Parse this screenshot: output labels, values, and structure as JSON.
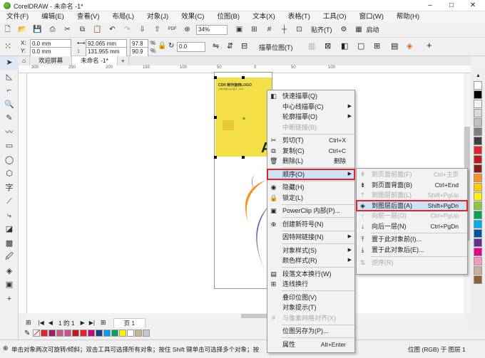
{
  "title": "CorelDRAW - 未命名 -1*",
  "menubar": [
    "文件(F)",
    "编辑(E)",
    "查看(V)",
    "布局(L)",
    "对象(J)",
    "效果(C)",
    "位图(B)",
    "文本(X)",
    "表格(T)",
    "工具(O)",
    "窗口(W)",
    "帮助(H)"
  ],
  "toolbar": {
    "zoom": "34%",
    "snap": "贴齐(T)",
    "launch": "启动"
  },
  "props": {
    "x": "0.0 mm",
    "y": "0.0 mm",
    "w": "92.065 mm",
    "h": "131.955 mm",
    "sx": "97.8",
    "sy": "90.9",
    "pct": "%",
    "angle": "0.0",
    "trace": "描摹位图(T)"
  },
  "tabs": [
    "欢迎屏幕",
    "未命名 -1*"
  ],
  "ruler": [
    "300",
    "250",
    "200",
    "150",
    "100",
    "50",
    "0",
    "50",
    "100"
  ],
  "poster": {
    "brand": "CDR 制作旋转LOGO",
    "sub": "小帆 科技 logo 设计 · corel",
    "letter": "A"
  },
  "menu": [
    {
      "label": "快速描摹(Q)",
      "icon": "trace-icon"
    },
    {
      "label": "中心线描摹(C)",
      "arrow": true
    },
    {
      "label": "轮廓描摹(O)",
      "arrow": true
    },
    {
      "label": "中断链接(B)",
      "dis": true
    },
    {
      "sep": true
    },
    {
      "label": "剪切(T)",
      "sc": "Ctrl+X",
      "icon": "cut-icon"
    },
    {
      "label": "复制(C)",
      "sc": "Ctrl+C",
      "icon": "copy-icon"
    },
    {
      "label": "删除(L)",
      "sc": "删除",
      "icon": "delete-icon"
    },
    {
      "sep": true
    },
    {
      "label": "顺序(O)",
      "arrow": true,
      "hl": true
    },
    {
      "sep": true
    },
    {
      "label": "隐藏(H)",
      "icon": "eye-icon"
    },
    {
      "label": "锁定(L)",
      "icon": "lock-icon"
    },
    {
      "sep": true
    },
    {
      "label": "PowerClip 内部(P)...",
      "icon": "powerclip-icon"
    },
    {
      "sep": true
    },
    {
      "label": "创建新符号(N)",
      "icon": "symbol-icon"
    },
    {
      "sep": true
    },
    {
      "label": "因特网链接(N)",
      "arrow": true
    },
    {
      "sep": true
    },
    {
      "label": "对象样式(S)",
      "arrow": true
    },
    {
      "label": "颜色样式(R)",
      "arrow": true
    },
    {
      "sep": true
    },
    {
      "label": "段落文本换行(W)",
      "icon": "wrap-icon"
    },
    {
      "label": "连线换行",
      "icon": "linewrap-icon"
    },
    {
      "sep": true
    },
    {
      "label": "叠印位图(V)"
    },
    {
      "label": "对象提示(T)"
    },
    {
      "label": "与像素网格对齐(X)",
      "dis": true,
      "icon": "grid-icon"
    },
    {
      "sep": true
    },
    {
      "label": "位图另存为(P)..."
    },
    {
      "sep": true
    },
    {
      "label": "属性",
      "sc": "Alt+Enter"
    }
  ],
  "submenu": [
    {
      "label": "到页面前面(F)",
      "sc": "Ctrl+主页",
      "dis": true,
      "icon": "front-page-icon"
    },
    {
      "label": "到页面背面(B)",
      "sc": "Ctrl+End",
      "icon": "back-page-icon"
    },
    {
      "label": "到图层前面(L)",
      "sc": "Shift+PgUp",
      "dis": true,
      "icon": "front-layer-icon"
    },
    {
      "label": "到图层后面(A)",
      "sc": "Shift+PgDn",
      "hl": true,
      "icon": "back-layer-icon"
    },
    {
      "label": "向前一层(O)",
      "sc": "Ctrl+PgUp",
      "dis": true,
      "icon": "forward-one-icon"
    },
    {
      "label": "向后一层(N)",
      "sc": "Ctrl+PgDn",
      "icon": "backward-one-icon"
    },
    {
      "sep": true
    },
    {
      "label": "置于此对象前(I)...",
      "icon": "in-front-icon"
    },
    {
      "label": "置于此对象后(E)...",
      "icon": "behind-icon"
    },
    {
      "sep": true
    },
    {
      "label": "逆序(R)",
      "dis": true,
      "icon": "reverse-icon"
    }
  ],
  "pagenav": {
    "count": "1 的 1",
    "page": "页 1"
  },
  "status": {
    "hint": "单击对象两次可旋转/倾斜；双击工具可选择所有对象；按住 Shift 键单击可选择多个对象；按",
    "center": "位图 (RGB) 于 图层 1"
  },
  "palette": [
    "#ffffff",
    "#000000",
    "#f2f2f2",
    "#d9d9d9",
    "#bfbfbf",
    "#808080",
    "#404040",
    "#e8212a",
    "#c0181f",
    "#8b1a1a",
    "#f7931e",
    "#ffcc00",
    "#fff200",
    "#8dc63f",
    "#00a651",
    "#00aeef",
    "#0054a6",
    "#662d91",
    "#ec008c",
    "#f49ac1",
    "#c7b299",
    "#8c6239"
  ],
  "docpal": [
    "#e8212a",
    "#9e1f63",
    "#c75b8a",
    "#d24c8d",
    "#c0181f",
    "#e8212a",
    "#c6007e",
    "#1b3f8b",
    "#00a0e9",
    "#00a651",
    "#fff200",
    "#ffffff",
    "#c8b68e",
    "#c6c6c6"
  ]
}
